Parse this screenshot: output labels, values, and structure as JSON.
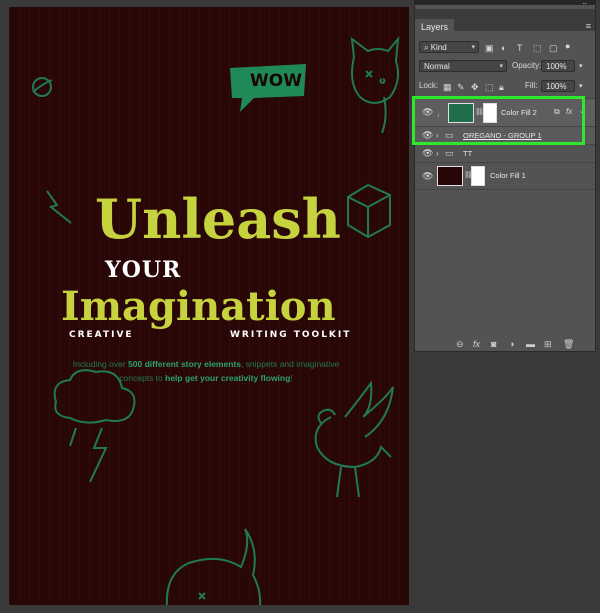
{
  "document": {
    "speech_bubble": "WOW",
    "title_line1": "Unleash",
    "title_line2": "YOUR",
    "title_line3": "Imagination",
    "subtitle_left": "CREATIVE",
    "subtitle_right": "WRITING TOOLKIT",
    "blurb_1": "Including over ",
    "blurb_highlight_1": "500 different story elements",
    "blurb_2": ", snippets and imaginative concepts to ",
    "blurb_highlight_2": "help get your creativity flowing",
    "blurb_3": "!",
    "colors": {
      "background": "#2a0707",
      "accent": "#c6d23e",
      "doodle": "#1f7a54",
      "white": "#ffffff"
    }
  },
  "panel": {
    "tab": "Layers",
    "filter_kind": "Kind",
    "blend_mode": "Normal",
    "opacity_label": "Opacity:",
    "opacity_value": "100%",
    "lock_label": "Lock:",
    "fill_label": "Fill:",
    "fill_value": "100%",
    "layers": [
      {
        "name": "Color Fill 2",
        "thumb_color": "#1e6e4c",
        "selected": true
      },
      {
        "name": "OREGANO - GROUP 1",
        "type": "group"
      },
      {
        "name": "TT",
        "type": "group"
      },
      {
        "name": "Color Fill 1",
        "thumb_color": "#2a0707"
      }
    ],
    "highlight_color": "#2ee82e"
  }
}
